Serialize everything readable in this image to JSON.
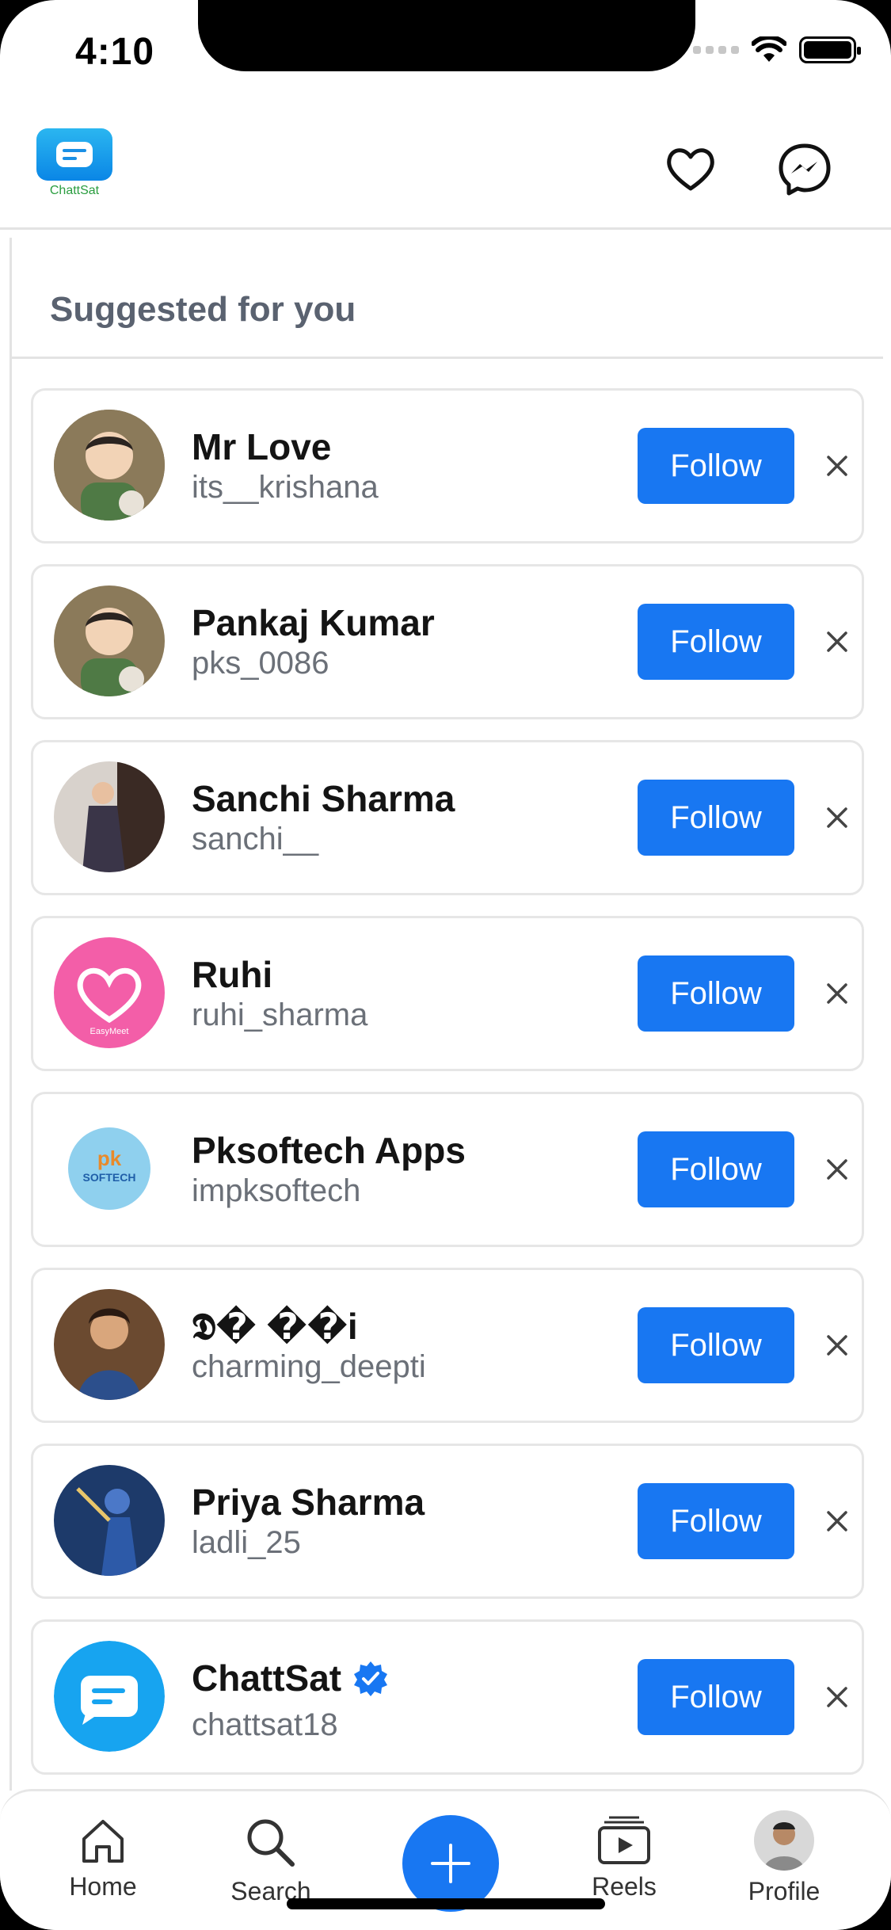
{
  "status": {
    "time": "4:10"
  },
  "header": {
    "brand": "ChattSat"
  },
  "section": {
    "title": "Suggested for you"
  },
  "suggestions": [
    {
      "name": "Mr Love",
      "handle": "its__krishana",
      "action": "Follow",
      "avatar": "boy-cartoon",
      "verified": false
    },
    {
      "name": "Pankaj Kumar",
      "handle": "pks_0086",
      "action": "Follow",
      "avatar": "boy-cartoon",
      "verified": false
    },
    {
      "name": "Sanchi Sharma",
      "handle": "sanchi__",
      "action": "Follow",
      "avatar": "woman-photo",
      "verified": false
    },
    {
      "name": "Ruhi",
      "handle": "ruhi_sharma",
      "action": "Follow",
      "avatar": "easymeet-logo",
      "verified": false
    },
    {
      "name": "Pksoftech Apps",
      "handle": "impksoftech",
      "action": "Follow",
      "avatar": "pksoftech-logo",
      "verified": false
    },
    {
      "name": "𝕯� ��i",
      "handle": "charming_deepti",
      "action": "Follow",
      "avatar": "woman-saree",
      "verified": false
    },
    {
      "name": "Priya Sharma",
      "handle": "ladli_25",
      "action": "Follow",
      "avatar": "krishna-art",
      "verified": false
    },
    {
      "name": "ChattSat",
      "handle": "chattsat18",
      "action": "Follow",
      "avatar": "chattsat-logo",
      "verified": true
    }
  ],
  "avatar_labels": {
    "easymeet": "EasyMeet",
    "pksoftech": "SOFTECH",
    "pk": "pk"
  },
  "tabs": {
    "home": "Home",
    "search": "Search",
    "reels": "Reels",
    "profile": "Profile"
  },
  "colors": {
    "accent": "#1877f2",
    "text": "#141414",
    "muted": "#6b7078"
  }
}
